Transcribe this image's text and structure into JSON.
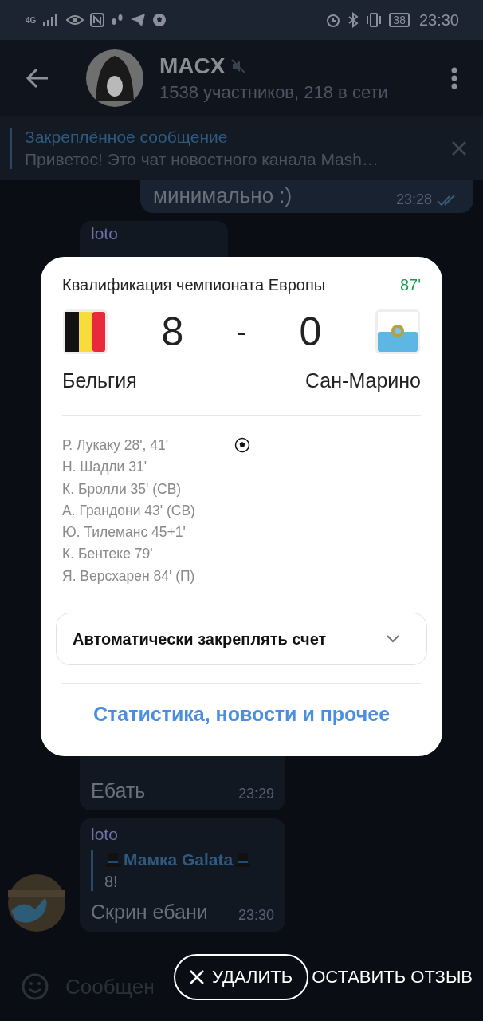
{
  "status_bar": {
    "network": "4G",
    "battery": "38",
    "time": "23:30"
  },
  "chat": {
    "title": "MACX",
    "muted": true,
    "subtitle": "1538 участников, 218 в сети"
  },
  "pinned": {
    "label": "Закреплённое сообщение",
    "text": "Приветос! Это чат новостного канала Mash…"
  },
  "messages": [
    {
      "kind": "outgoing",
      "text": "минимально :)",
      "time": "23:28",
      "read": true
    },
    {
      "kind": "incoming",
      "sender": "loto"
    },
    {
      "kind": "incoming",
      "text": "Ебать",
      "time": "23:29"
    },
    {
      "kind": "incoming",
      "sender": "loto",
      "quote_author": "Мамка Galata",
      "quote_text": "8!",
      "text": "Скрин ебани",
      "time": "23:30"
    }
  ],
  "match": {
    "competition": "Квалификация чемпионата Европы",
    "minute": "87'",
    "home": {
      "name": "Бельгия",
      "score": "8"
    },
    "separator": "-",
    "away": {
      "name": "Сан-Марино",
      "score": "0"
    },
    "scorers": [
      "Р. Лукаку 28', 41'",
      "Н. Шадли 31'",
      "К. Бролли 35' (СВ)",
      "А. Грандони 43' (СВ)",
      "Ю. Тилеманс 45+1'",
      "К. Бентеке 79'",
      "Я. Версхарен 84' (П)"
    ],
    "autopin": "Автоматически закреплять счет",
    "link": "Статистика, новости и прочее"
  },
  "composer": {
    "placeholder": "Сообщен"
  },
  "toast": {
    "delete": "УДАЛИТЬ",
    "feedback": "ОСТАВИТЬ ОТЗЫВ"
  }
}
